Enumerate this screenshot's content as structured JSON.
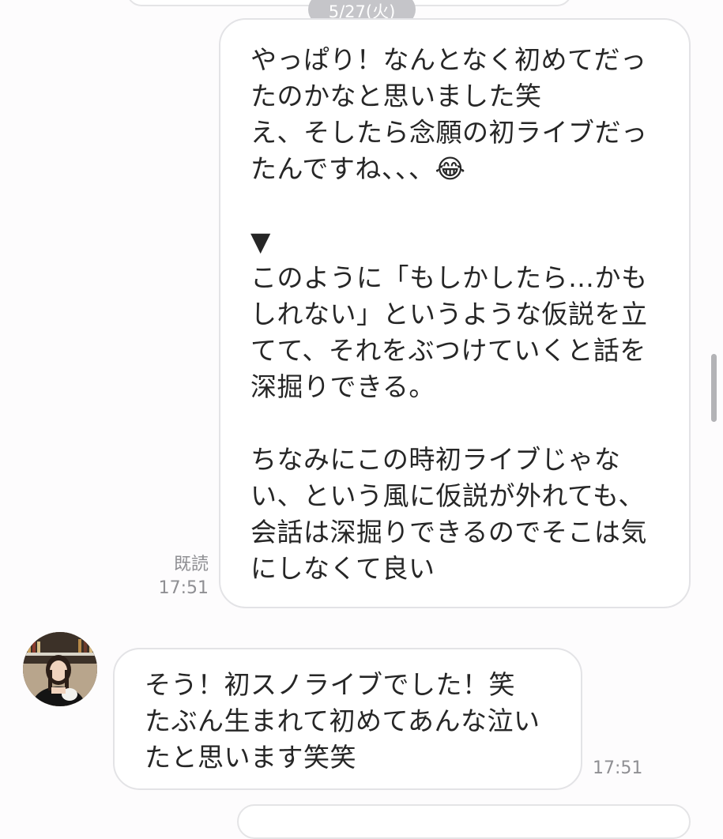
{
  "date_label": "5/27(火)",
  "sent_message": {
    "text": "やっぱり！なんとなく初めてだったのかなと思いました笑\nえ、そしたら念願の初ライブだったんですね、、、😂\n\n▼\nこのように「もしかしたら…かもしれない」というような仮説を立てて、それをぶつけていくと話を深掘りできる。\n\nちなみにこの時初ライブじゃない、という風に仮説が外れても、会話は深掘りできるのでそこは気にしなくて良い",
    "read_label": "既読",
    "time": "17:51"
  },
  "received_message": {
    "text": "そう！初スノライブでした！笑\nたぶん生まれて初めてあんな泣いたと思います笑笑",
    "time": "17:51"
  },
  "colors": {
    "background": "#fdfcfd",
    "bubble": "#ffffff",
    "bubble_border": "#e3e3e6",
    "date_pill": "#c5c5c9",
    "meta_text": "#8f8f93"
  }
}
